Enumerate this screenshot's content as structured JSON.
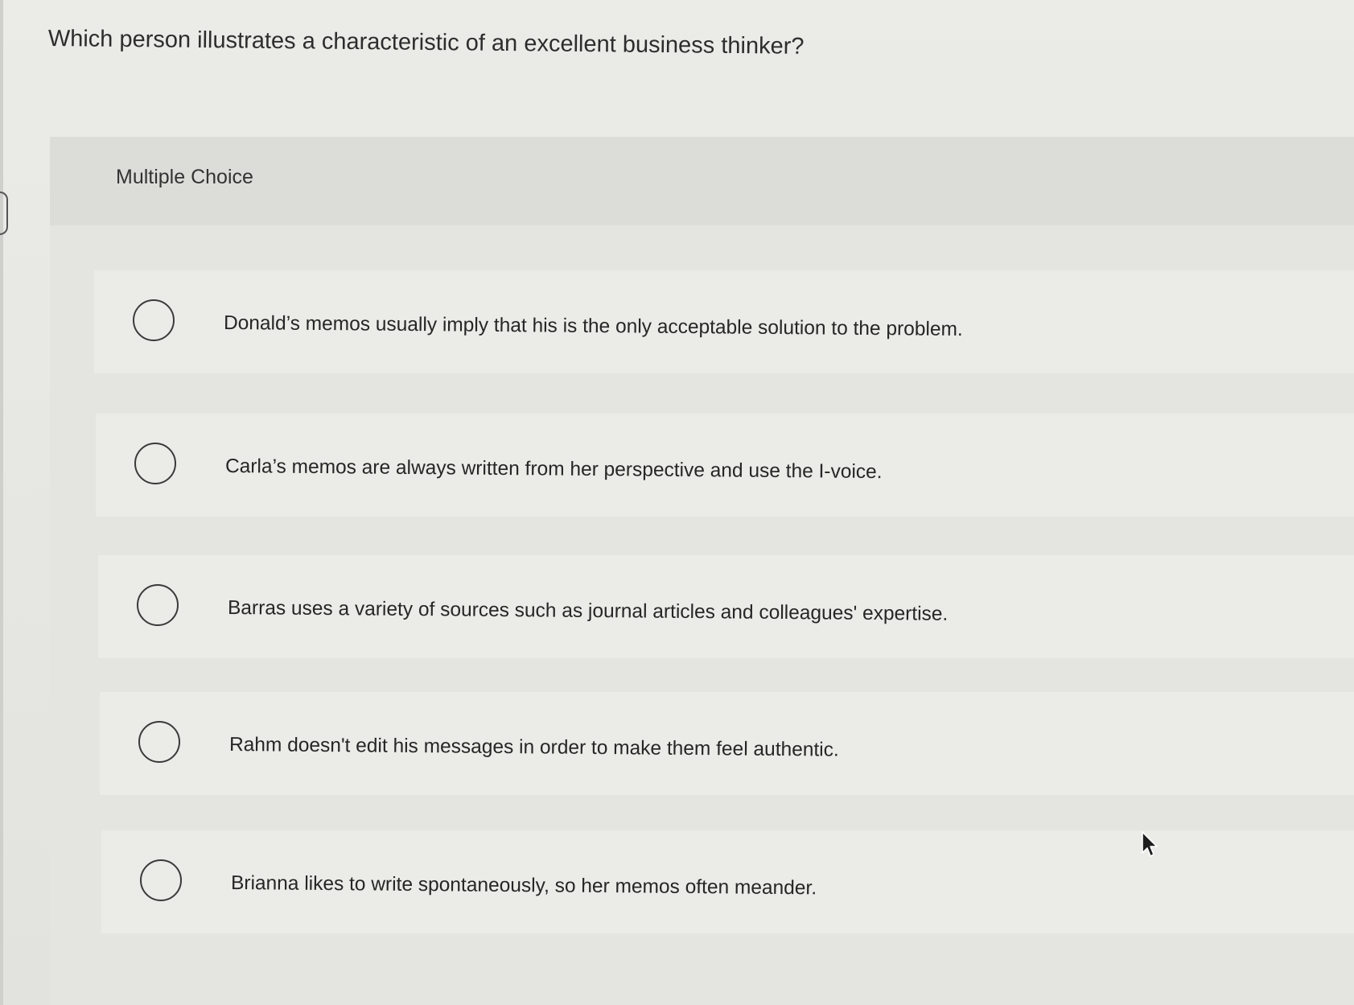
{
  "question": {
    "text": "Which person illustrates a characteristic of an excellent business thinker?"
  },
  "panel": {
    "type_label": "Multiple Choice"
  },
  "choices": [
    {
      "label": "Donald’s memos usually imply that his is the only acceptable solution to the problem.",
      "selected": false
    },
    {
      "label": "Carla’s memos are always written from her perspective and use the I-voice.",
      "selected": false
    },
    {
      "label": "Barras uses a variety of sources such as journal articles and colleagues' expertise.",
      "selected": false
    },
    {
      "label": "Rahm doesn't edit his messages in order to make them feel authentic.",
      "selected": false
    },
    {
      "label": "Brianna likes to write spontaneously, so her memos often meander.",
      "selected": false
    }
  ],
  "icons": {
    "radio": "radio-unchecked-icon",
    "pointer": "mouse-pointer-icon"
  },
  "colors": {
    "background": "#e9e9e5",
    "panel": "#e4e4e0",
    "option_row": "#ebebe7",
    "text": "#2b2b2b",
    "radio_border": "#3a3a3a"
  }
}
